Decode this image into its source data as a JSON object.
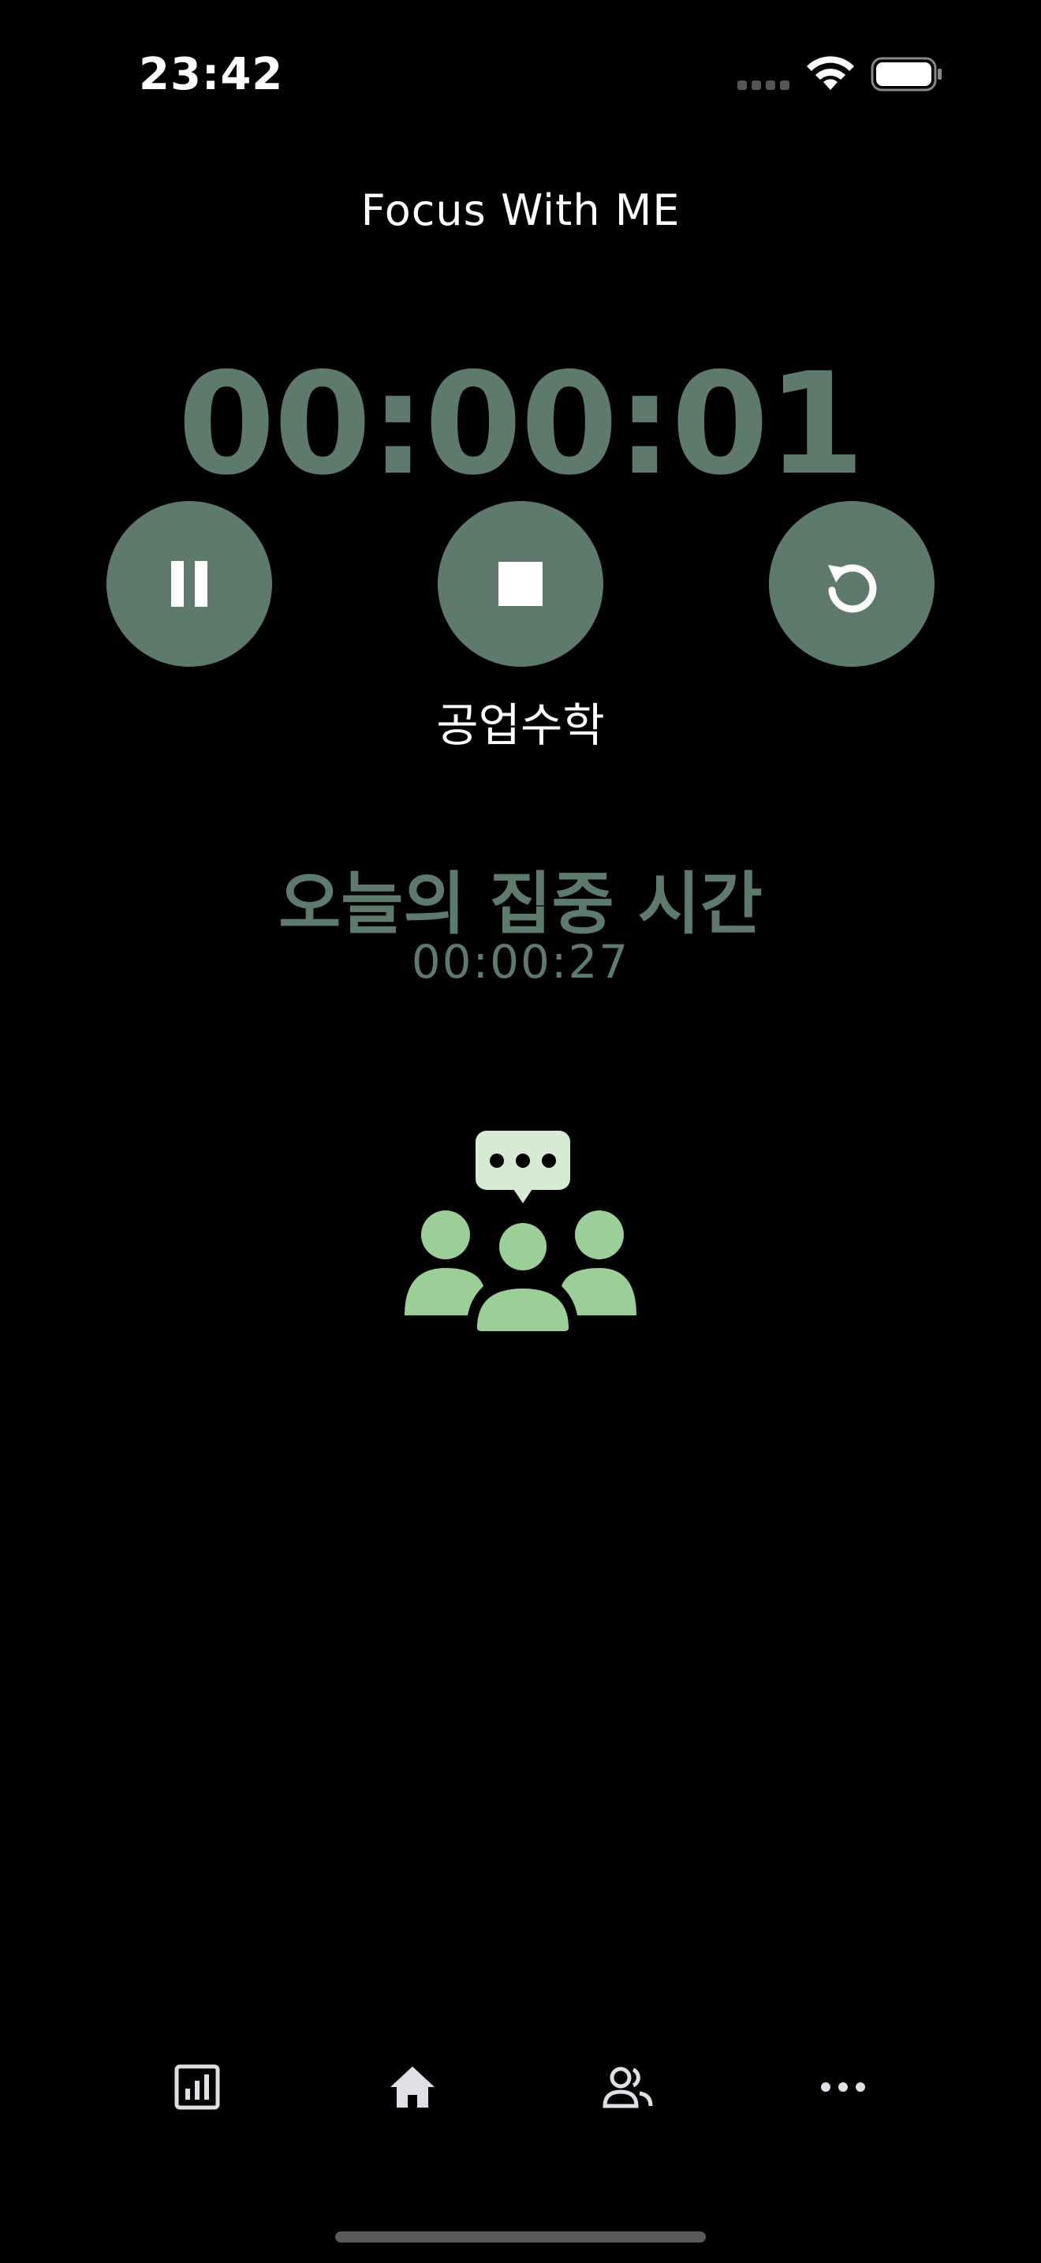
{
  "status_bar": {
    "time": "23:42"
  },
  "header": {
    "title": "Focus With ME"
  },
  "timer": {
    "display": "00:00:01"
  },
  "controls": [
    {
      "name": "pause",
      "icon": "pause-icon"
    },
    {
      "name": "stop",
      "icon": "stop-icon"
    },
    {
      "name": "reset",
      "icon": "reset-icon"
    }
  ],
  "subject": {
    "name": "공업수학"
  },
  "today": {
    "label": "오늘의 집중 시간",
    "total": "00:00:27"
  },
  "community_icon": "group-chat-icon",
  "tab_bar": [
    {
      "name": "stats",
      "icon": "bar-chart-icon"
    },
    {
      "name": "home",
      "icon": "home-icon"
    },
    {
      "name": "friends",
      "icon": "people-icon"
    },
    {
      "name": "more",
      "icon": "more-icon"
    }
  ],
  "colors": {
    "accent": "#5e7a6c",
    "icon_green": "#9ccf98",
    "bubble": "#d7ead3",
    "tab_icon": "#e0dfe6"
  }
}
